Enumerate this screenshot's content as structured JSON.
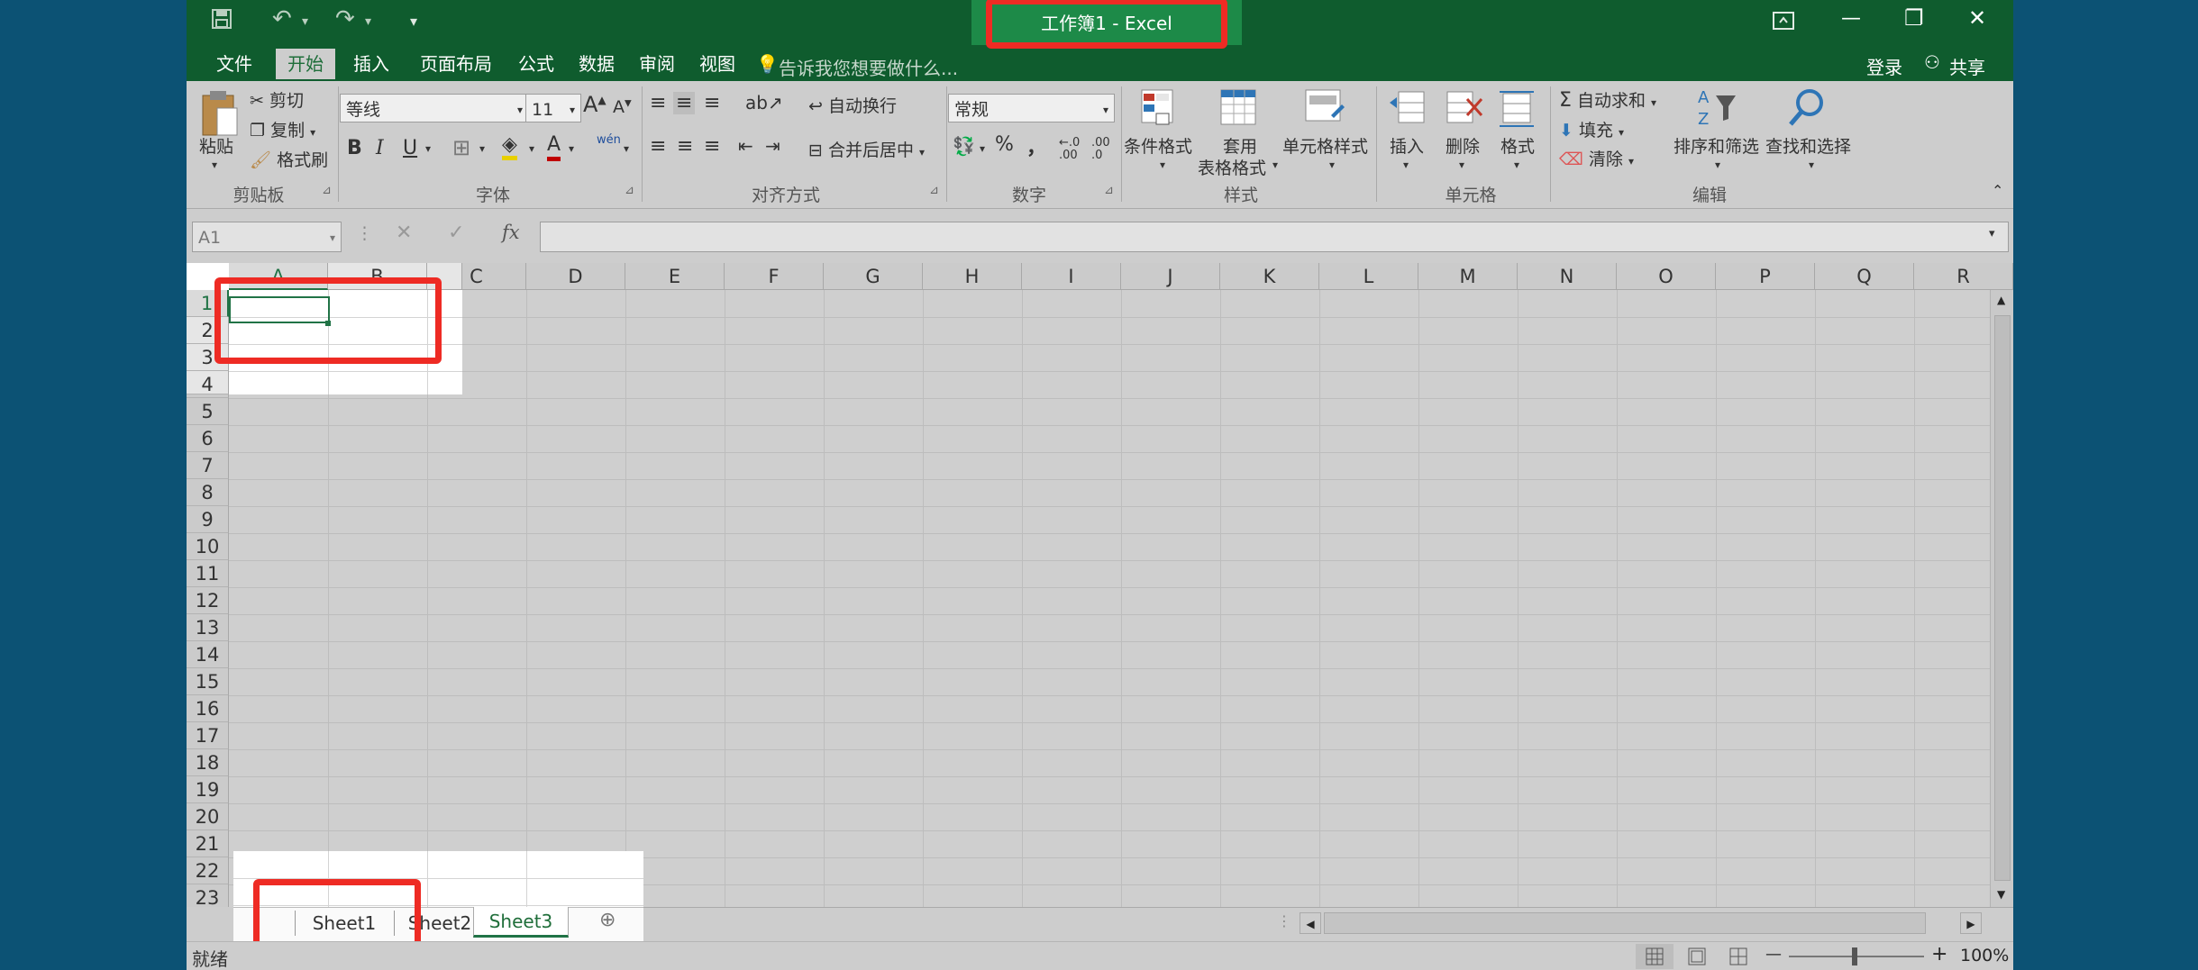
{
  "window": {
    "title": "工作簿1 - Excel"
  },
  "qat": {
    "save_icon": "save-icon",
    "undo_icon": "undo-icon",
    "redo_icon": "redo-icon",
    "customize_icon": "customize-qat-icon"
  },
  "window_controls": {
    "ribbon_display_icon": "ribbon-display-icon",
    "minimize": "—",
    "restore": "❐",
    "close": "✕"
  },
  "tabs": [
    {
      "label": "文件",
      "active": false
    },
    {
      "label": "开始",
      "active": true
    },
    {
      "label": "插入",
      "active": false
    },
    {
      "label": "页面布局",
      "active": false
    },
    {
      "label": "公式",
      "active": false
    },
    {
      "label": "数据",
      "active": false
    },
    {
      "label": "审阅",
      "active": false
    },
    {
      "label": "视图",
      "active": false
    }
  ],
  "tell_me": {
    "placeholder": "告诉我您想要做什么..."
  },
  "account": {
    "login": "登录",
    "share": "共享"
  },
  "ribbon": {
    "clipboard": {
      "paste": "粘贴",
      "cut": "剪切",
      "copy": "复制",
      "format_painter": "格式刷",
      "group": "剪贴板"
    },
    "font": {
      "name": "等线",
      "size": "11",
      "grow": "A",
      "shrink": "A",
      "bold": "B",
      "italic": "I",
      "underline": "U",
      "font_color": "A",
      "phonetic": "wén",
      "group": "字体"
    },
    "alignment": {
      "wrap_text": "自动换行",
      "merge_center": "合并后居中",
      "group": "对齐方式"
    },
    "number": {
      "format": "常规",
      "percent": "%",
      "comma": "，",
      "inc_decimal": ".00",
      "dec_decimal": ".0",
      "group": "数字"
    },
    "styles": {
      "conditional": "条件格式",
      "table_line1": "套用",
      "table_line2": "表格格式",
      "cell_styles": "单元格样式",
      "group": "样式"
    },
    "cells": {
      "insert": "插入",
      "delete": "删除",
      "format": "格式",
      "group": "单元格"
    },
    "editing": {
      "autosum": "自动求和",
      "fill": "填充",
      "clear": "清除",
      "sort_filter": "排序和筛选",
      "find_select": "查找和选择",
      "group": "编辑"
    }
  },
  "formula_bar": {
    "name_box": "A1",
    "cancel": "✕",
    "enter": "✓",
    "fx": "fx",
    "value": ""
  },
  "columns": [
    "A",
    "B",
    "C",
    "D",
    "E",
    "F",
    "G",
    "H",
    "I",
    "J",
    "K",
    "L",
    "M",
    "N",
    "O",
    "P",
    "Q",
    "R"
  ],
  "rows": [
    "1",
    "2",
    "3",
    "4",
    "5",
    "6",
    "7",
    "8",
    "9",
    "10",
    "11",
    "12",
    "13",
    "14",
    "15",
    "16",
    "17",
    "18",
    "19",
    "20",
    "21",
    "22",
    "23"
  ],
  "sheets": [
    {
      "name": "Sheet1",
      "active": false
    },
    {
      "name": "Sheet2",
      "active": false
    },
    {
      "name": "Sheet3",
      "active": true
    }
  ],
  "status": {
    "ready": "就绪",
    "zoom": "100%",
    "zoom_minus": "—",
    "zoom_plus": "+"
  },
  "colors": {
    "title_bar": "#0f5c2e",
    "title_highlight": "#1d8a48",
    "annotation_red": "#ee2b24",
    "active_green": "#1f6e3a"
  }
}
